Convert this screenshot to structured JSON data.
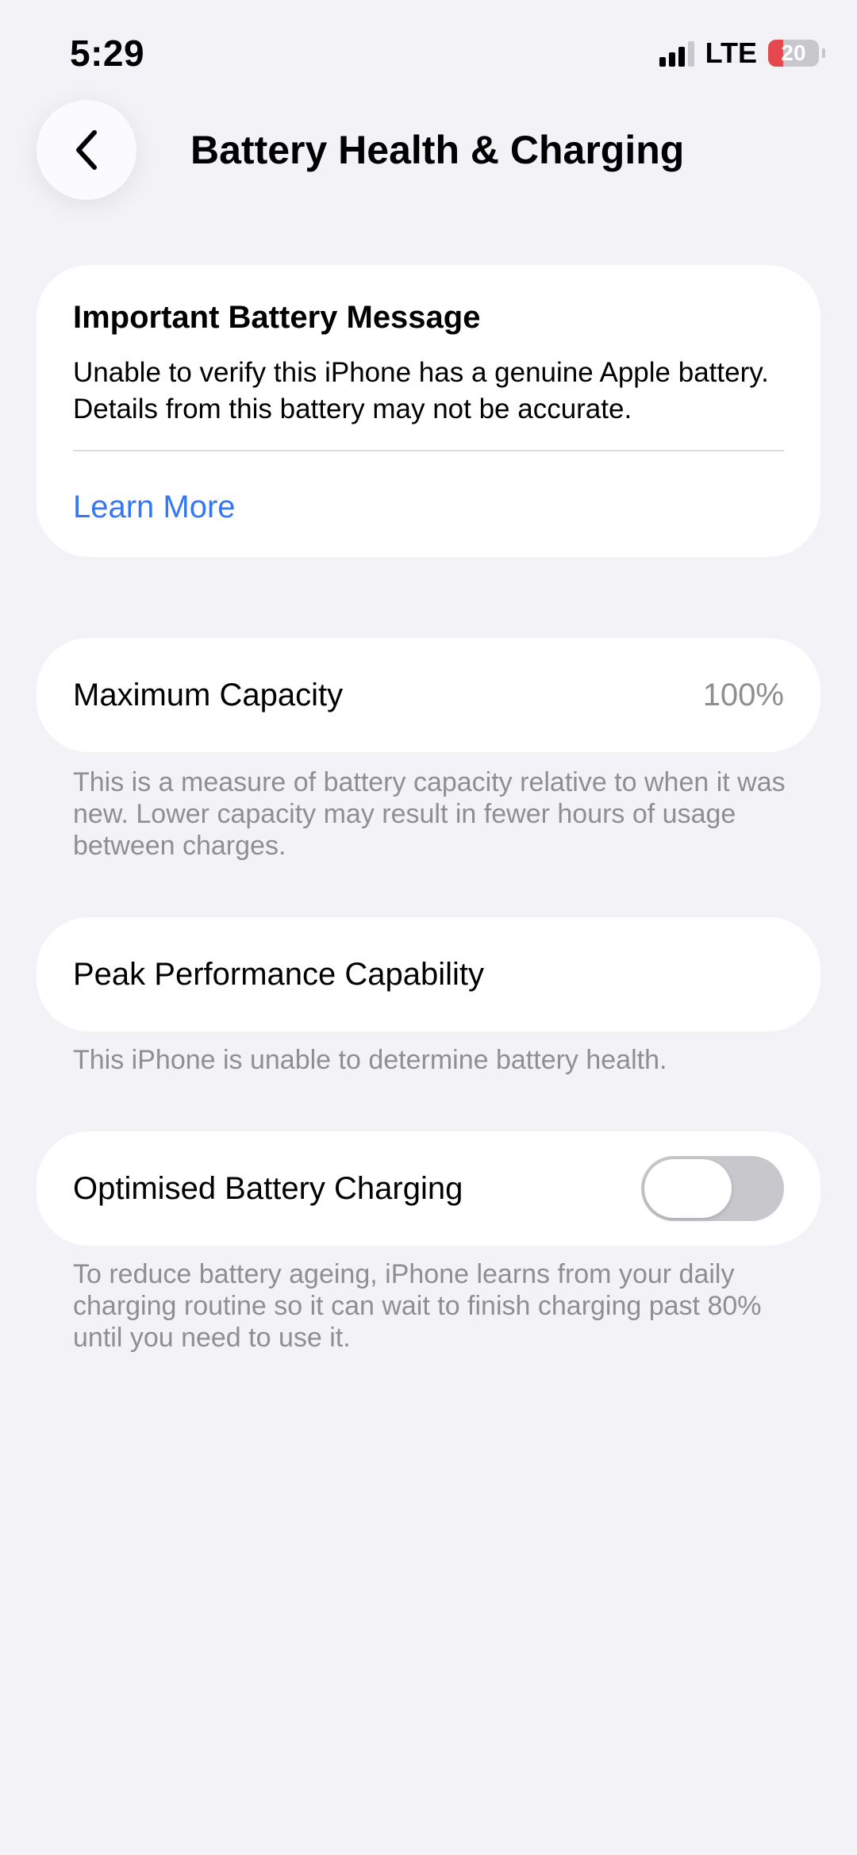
{
  "status_bar": {
    "time": "5:29",
    "network": "LTE",
    "battery_level": "20",
    "signal_icon": "cellular-signal-icon",
    "battery_icon": "battery-icon"
  },
  "nav": {
    "back_icon": "chevron-left-icon",
    "title": "Battery Health & Charging"
  },
  "message_card": {
    "title": "Important Battery Message",
    "body": "Unable to verify this iPhone has a genuine Apple battery. Details from this battery may not be accurate.",
    "link_label": "Learn More",
    "link_color": "#3478f6"
  },
  "maximum_capacity": {
    "label": "Maximum Capacity",
    "value": "100%",
    "footnote": "This is a measure of battery capacity relative to when it was new. Lower capacity may result in fewer hours of usage between charges."
  },
  "peak_performance": {
    "label": "Peak Performance Capability",
    "footnote": "This iPhone is unable to determine battery health."
  },
  "optimised_charging": {
    "label": "Optimised Battery Charging",
    "enabled": false,
    "footnote": "To reduce battery ageing, iPhone learns from your daily charging routine so it can wait to finish charging past 80% until you need to use it."
  }
}
